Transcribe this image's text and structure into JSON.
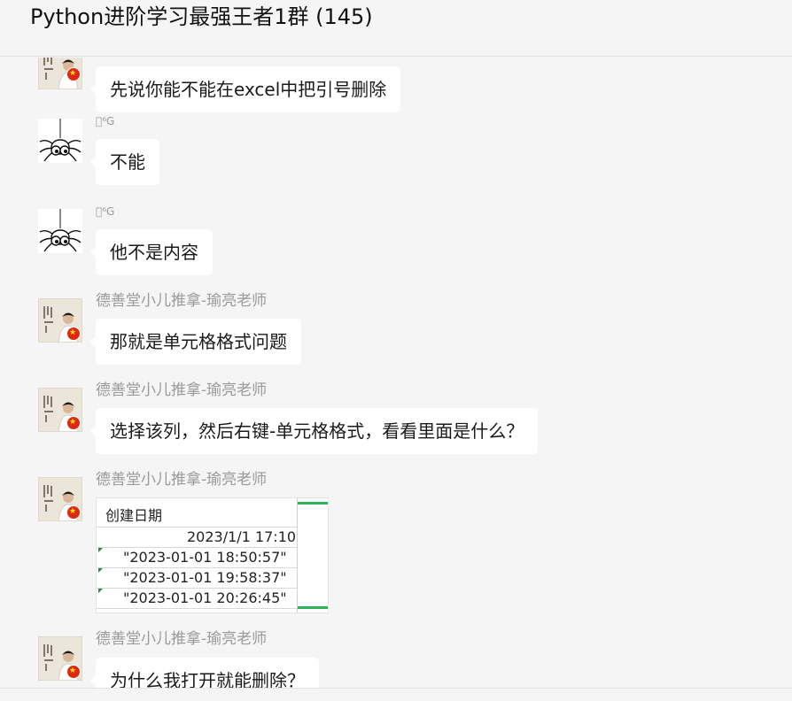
{
  "header": {
    "title": "Python进阶学习最强王者1群 (145)"
  },
  "messages": [
    {
      "sender": "",
      "text": "先说你能不能在excel中把引号删除",
      "avatar": "teacher-avatar"
    },
    {
      "sender": "⁶G",
      "text": "不能",
      "avatar": "spider-avatar"
    },
    {
      "sender": "⁶G",
      "text": "他不是内容",
      "avatar": "spider-avatar"
    },
    {
      "sender": "德善堂小儿推拿-瑜亮老师",
      "text": "那就是单元格格式问题",
      "avatar": "teacher-avatar"
    },
    {
      "sender": "德善堂小儿推拿-瑜亮老师",
      "text": "选择该列，然后右键-单元格格式，看看里面是什么？",
      "avatar": "teacher-avatar"
    },
    {
      "sender": "德善堂小儿推拿-瑜亮老师",
      "text": "",
      "avatar": "teacher-avatar",
      "image": {
        "header": "创建日期",
        "rows": [
          "2023/1/1 17:10",
          "\"2023-01-01 18:50:57\"",
          "\"2023-01-01 19:58:37\"",
          "\"2023-01-01 20:26:45\""
        ]
      }
    },
    {
      "sender": "德善堂小儿推拿-瑜亮老师",
      "text": "为什么我打开就能删除？",
      "avatar": "teacher-avatar"
    }
  ],
  "colors": {
    "background": "#f5f5f5",
    "bubble": "#ffffff",
    "sender_text": "#9a9a9a",
    "flag_red": "#de2910",
    "excel_green": "#2bb35a"
  }
}
